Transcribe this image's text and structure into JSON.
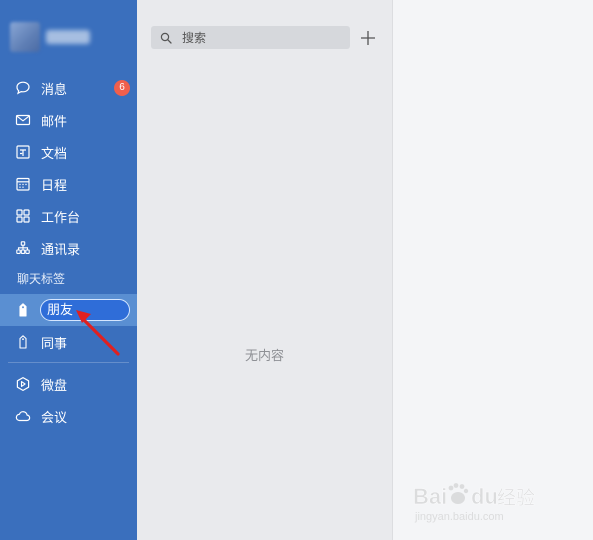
{
  "sidebar": {
    "items": [
      {
        "label": "消息",
        "icon": "chat-bubble-icon",
        "badge": "6"
      },
      {
        "label": "邮件",
        "icon": "mail-icon"
      },
      {
        "label": "文档",
        "icon": "document-icon"
      },
      {
        "label": "日程",
        "icon": "calendar-icon"
      },
      {
        "label": "工作台",
        "icon": "grid-icon"
      },
      {
        "label": "通讯录",
        "icon": "org-chart-icon"
      }
    ],
    "tags_section_label": "聊天标签",
    "tags": [
      {
        "label": "朋友",
        "icon": "tag-icon",
        "editing": true
      },
      {
        "label": "同事",
        "icon": "tag-icon"
      }
    ],
    "bottom_items": [
      {
        "label": "微盘",
        "icon": "drive-icon"
      },
      {
        "label": "会议",
        "icon": "cloud-meeting-icon"
      }
    ],
    "accent_color": "#3a6fbd",
    "active_color": "#5a8fd2",
    "badge_color": "#f05f4c"
  },
  "middle": {
    "search": {
      "placeholder": "搜索",
      "value": ""
    },
    "empty_text": "无内容"
  },
  "annotation": {
    "arrow_color": "#e02020",
    "icon": "red-arrow-icon"
  },
  "watermark": {
    "brand": "Bai",
    "brand2": "du",
    "suffix": "经验",
    "url": "jingyan.baidu.com"
  }
}
